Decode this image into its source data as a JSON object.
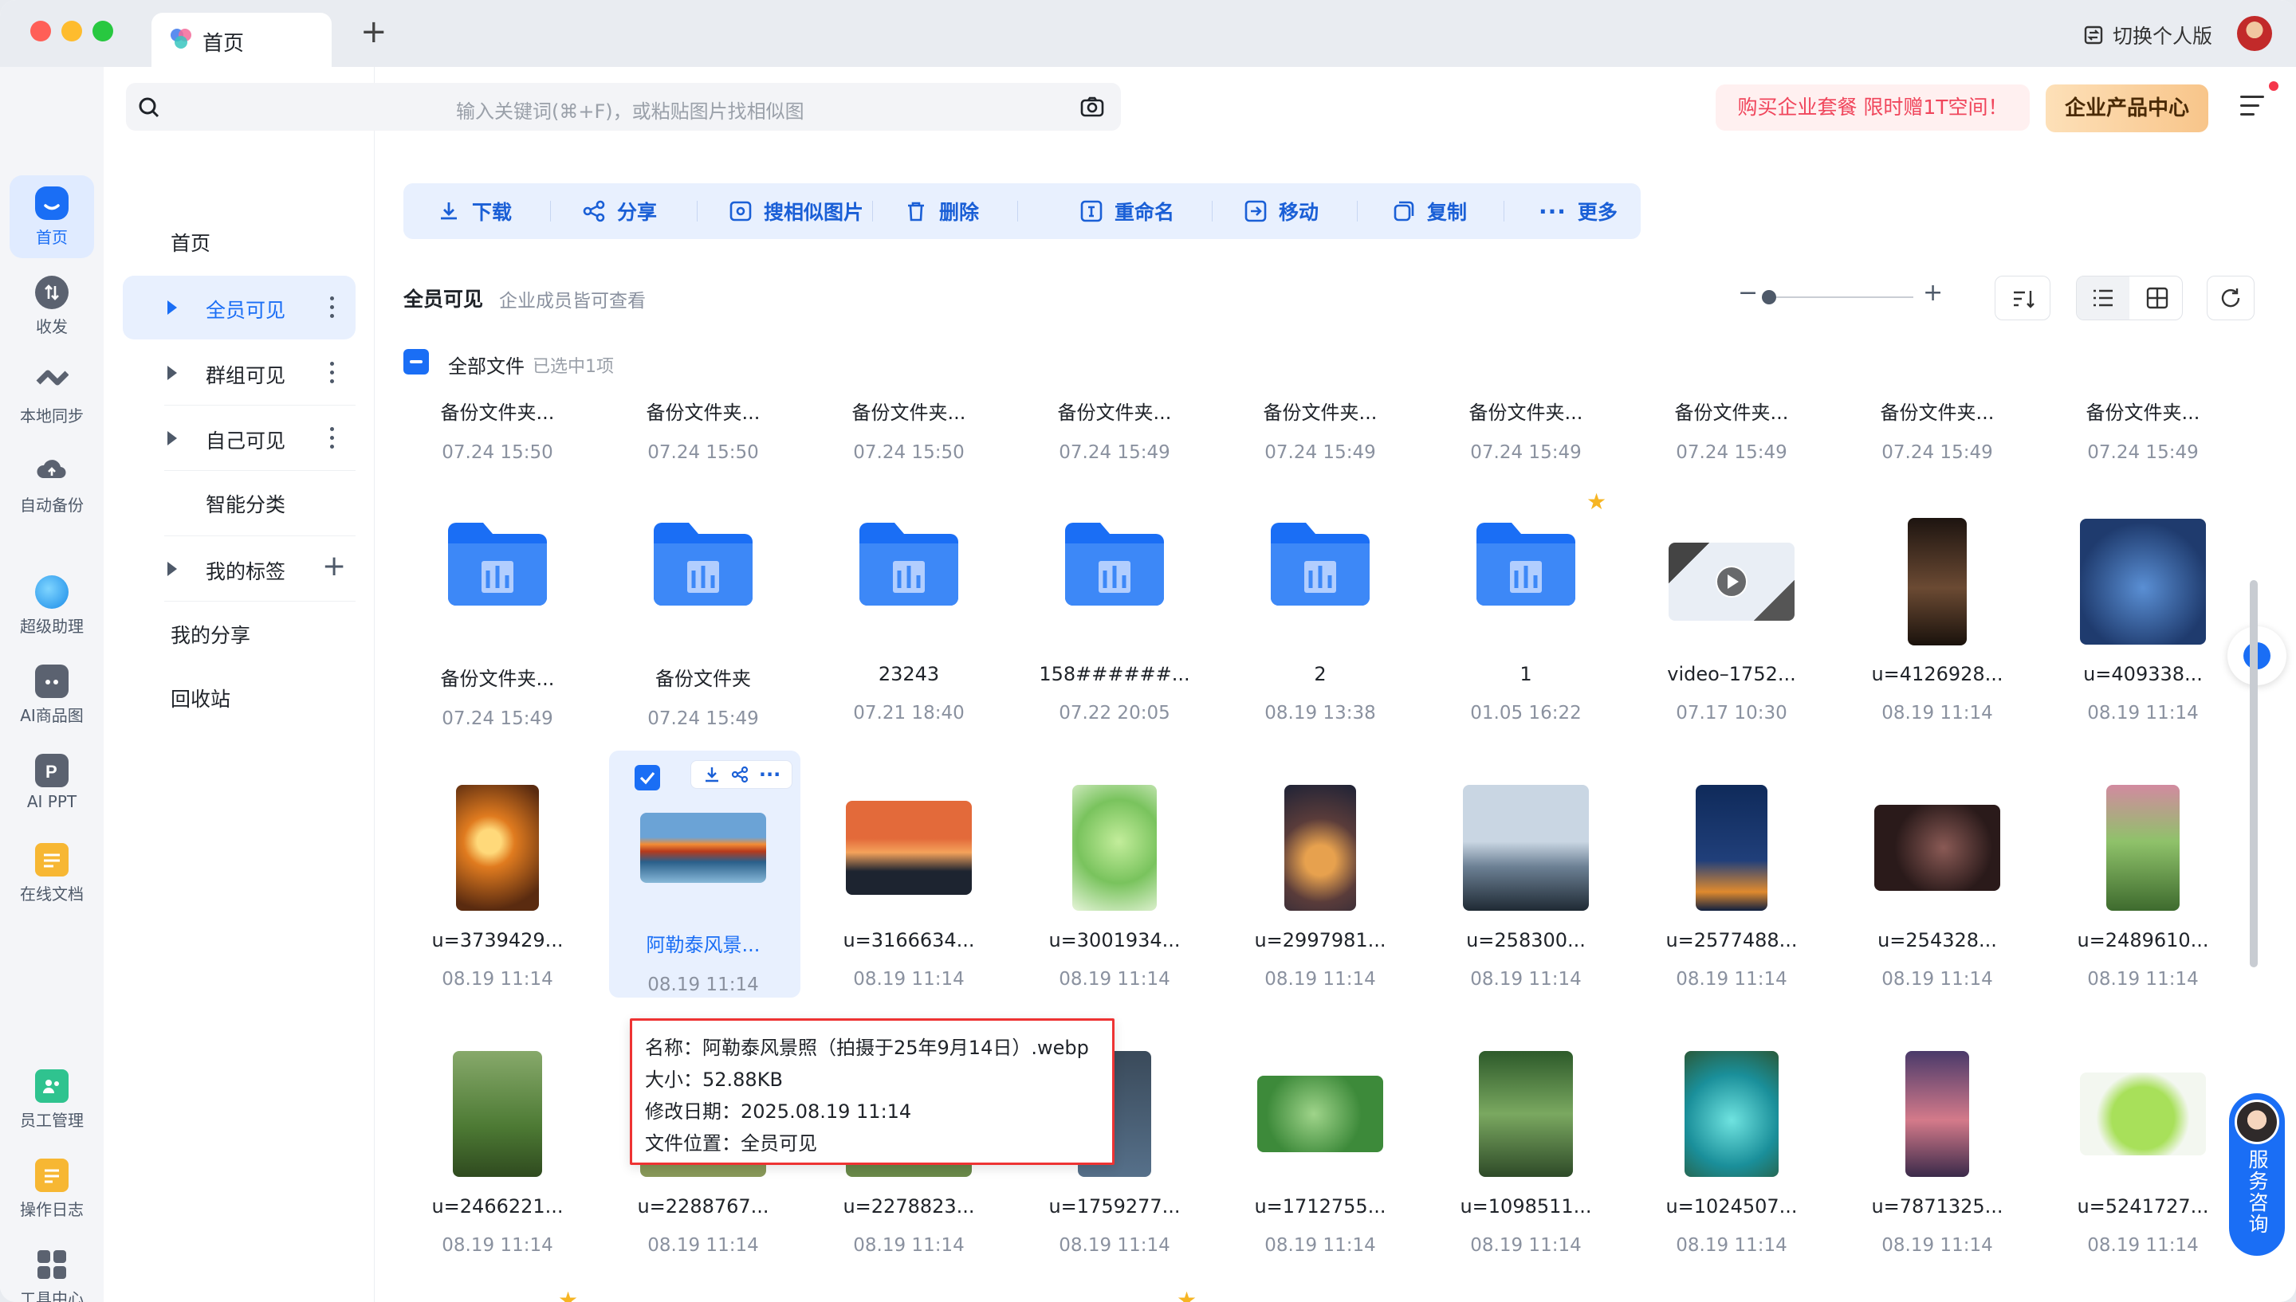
{
  "window": {
    "tab_title": "首页",
    "new_tab": "+",
    "switch_label": "切换个人版"
  },
  "rail": {
    "items": [
      {
        "label": "首页",
        "icon": "home-icon"
      },
      {
        "label": "收发",
        "icon": "transfer-icon"
      },
      {
        "label": "本地同步",
        "icon": "sync-icon"
      },
      {
        "label": "自动备份",
        "icon": "backup-icon"
      },
      {
        "label": "超级助理",
        "icon": "assistant-icon"
      },
      {
        "label": "AI商品图",
        "icon": "ai-product-icon"
      },
      {
        "label": "AI PPT",
        "icon": "ai-ppt-icon"
      },
      {
        "label": "在线文档",
        "icon": "online-doc-icon"
      },
      {
        "label": "员工管理",
        "icon": "staff-icon"
      },
      {
        "label": "操作日志",
        "icon": "log-icon"
      },
      {
        "label": "工具中心",
        "icon": "tools-icon"
      }
    ]
  },
  "nav": {
    "home": "首页",
    "public": "全员可见",
    "group": "群组可见",
    "private": "自己可见",
    "smart": "智能分类",
    "tags": "我的标签",
    "shares": "我的分享",
    "recycle": "回收站"
  },
  "search": {
    "placeholder": "输入关键词(⌘+F)，或粘贴图片找相似图"
  },
  "promo": {
    "text": "购买企业套餐 限时赠1T空间！",
    "enterprise": "企业产品中心"
  },
  "toolbar": {
    "download": "下载",
    "share": "分享",
    "similar": "搜相似图片",
    "delete": "删除",
    "rename": "重命名",
    "move": "移动",
    "copy": "复制",
    "more": "更多"
  },
  "header": {
    "title": "全员可见",
    "subtitle": "企业成员皆可查看",
    "all_files": "全部文件",
    "selected": "已选中1项",
    "zoom_minus": "−",
    "zoom_plus": "+"
  },
  "files": [
    {
      "name": "备份文件夹...",
      "date": "07.24 15:50"
    },
    {
      "name": "备份文件夹...",
      "date": "07.24 15:50"
    },
    {
      "name": "备份文件夹...",
      "date": "07.24 15:50"
    },
    {
      "name": "备份文件夹...",
      "date": "07.24 15:49"
    },
    {
      "name": "备份文件夹...",
      "date": "07.24 15:49"
    },
    {
      "name": "备份文件夹...",
      "date": "07.24 15:49"
    },
    {
      "name": "备份文件夹...",
      "date": "07.24 15:49"
    },
    {
      "name": "备份文件夹...",
      "date": "07.24 15:49"
    },
    {
      "name": "备份文件夹...",
      "date": "07.24 15:49"
    },
    {
      "name": "备份文件夹...",
      "date": "07.24 15:49",
      "kind": "folder"
    },
    {
      "name": "备份文件夹",
      "date": "07.24 15:49",
      "kind": "folder"
    },
    {
      "name": "23243",
      "date": "07.21 18:40",
      "kind": "folder"
    },
    {
      "name": "158######...",
      "date": "07.22 20:05",
      "kind": "folder"
    },
    {
      "name": "2",
      "date": "08.19 13:38",
      "kind": "folder"
    },
    {
      "name": "1",
      "date": "01.05 16:22",
      "kind": "folder"
    },
    {
      "name": "video–1752...",
      "date": "07.17 10:30",
      "kind": "video"
    },
    {
      "name": "u=4126928...",
      "date": "08.19 11:14",
      "kind": "image"
    },
    {
      "name": "u=409338...",
      "date": "08.19 11:14",
      "kind": "image"
    },
    {
      "name": "u=3739429...",
      "date": "08.19 11:14",
      "kind": "image"
    },
    {
      "name": "阿勒泰风景...",
      "date": "08.19 11:14",
      "kind": "image"
    },
    {
      "name": "u=3166634...",
      "date": "08.19 11:14",
      "kind": "image"
    },
    {
      "name": "u=3001934...",
      "date": "08.19 11:14",
      "kind": "image"
    },
    {
      "name": "u=2997981...",
      "date": "08.19 11:14",
      "kind": "image"
    },
    {
      "name": "u=258300...",
      "date": "08.19 11:14",
      "kind": "image"
    },
    {
      "name": "u=2577488...",
      "date": "08.19 11:14",
      "kind": "image"
    },
    {
      "name": "u=254328...",
      "date": "08.19 11:14",
      "kind": "image"
    },
    {
      "name": "u=2489610...",
      "date": "08.19 11:14",
      "kind": "image"
    },
    {
      "name": "u=2466221...",
      "date": "08.19 11:14",
      "kind": "image"
    },
    {
      "name": "u=2288767...",
      "date": "08.19 11:14",
      "kind": "image"
    },
    {
      "name": "u=2278823...",
      "date": "08.19 11:14",
      "kind": "image"
    },
    {
      "name": "u=1759277...",
      "date": "08.19 11:14",
      "kind": "image"
    },
    {
      "name": "u=1712755...",
      "date": "08.19 11:14",
      "kind": "image"
    },
    {
      "name": "u=1098511...",
      "date": "08.19 11:14",
      "kind": "image"
    },
    {
      "name": "u=1024507...",
      "date": "08.19 11:14",
      "kind": "image"
    },
    {
      "name": "u=7871325...",
      "date": "08.19 11:14",
      "kind": "image"
    },
    {
      "name": "u=5241727...",
      "date": "08.19 11:14",
      "kind": "image"
    }
  ],
  "tooltip": {
    "name": "名称：阿勒泰风景照（拍摄于25年9月14日）.webp",
    "size": "大小：52.88KB",
    "modified": "修改日期：2025.08.19 11:14",
    "location": "文件位置：全员可见"
  },
  "service": {
    "label": "服务咨询"
  },
  "colors": {
    "accent": "#1a6ef5",
    "promo_text": "#f0455b",
    "tooltip_border": "#ee3333",
    "star": "#f6b524"
  }
}
